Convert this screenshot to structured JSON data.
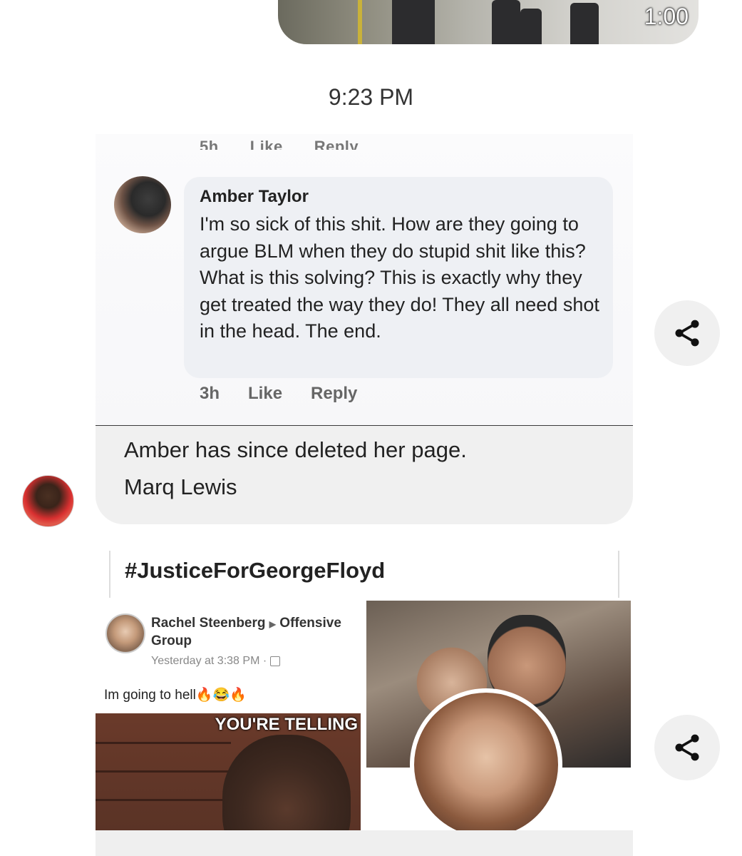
{
  "video": {
    "duration": "1:00"
  },
  "timestamp": "9:23 PM",
  "comment_screenshot": {
    "cut_row": {
      "time": "5h",
      "like": "Like",
      "reply": "Reply"
    },
    "author": "Amber Taylor",
    "text": "I'm so sick of this shit. How are they going to argue BLM when they do stupid shit like this? What is this solving? This is exactly why they get treated the way they do! They all need shot in the head. The end.",
    "actions": {
      "time": "3h",
      "like": "Like",
      "reply": "Reply"
    }
  },
  "caption": {
    "line1": "Amber has since deleted her page.",
    "line2": "Marq Lewis"
  },
  "shared_image": {
    "hashtag": "#JusticeForGeorgeFloyd",
    "post": {
      "author": "Rachel Steenberg",
      "group": "Offensive Group",
      "time": "Yesterday at 3:38 PM ·",
      "text": "Im going to hell🔥😂🔥"
    },
    "meme_caption": "YOU'RE TELLING"
  },
  "icons": {
    "share": "share-icon"
  }
}
